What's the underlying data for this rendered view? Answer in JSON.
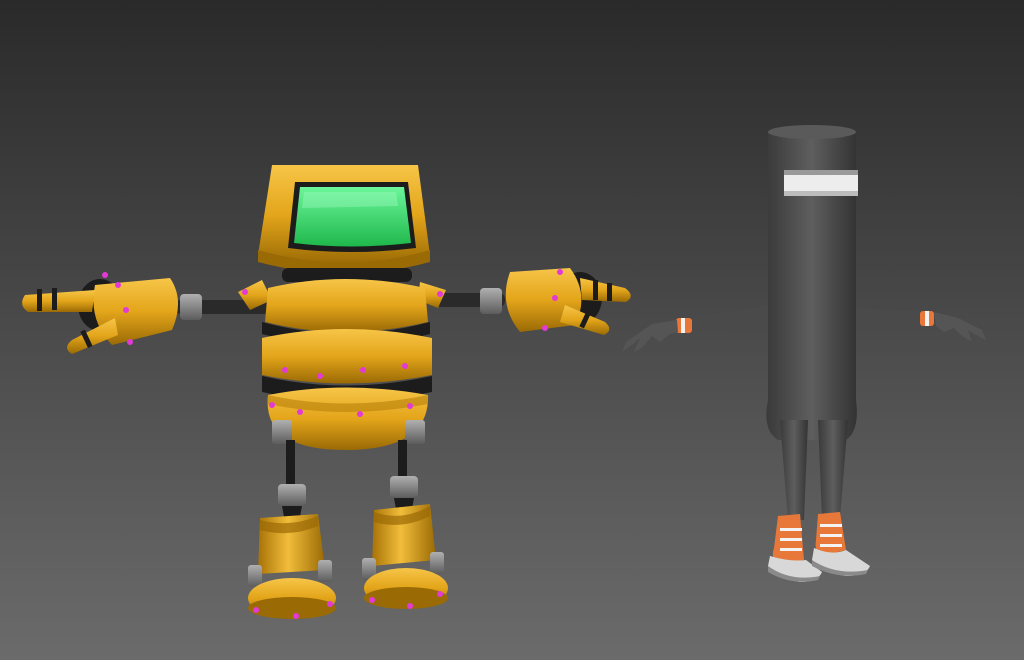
{
  "viewport": {
    "background_top": "#2a2a2a",
    "background_bottom": "#6b6b6b"
  },
  "models": [
    {
      "name": "yellow-robot",
      "colors": {
        "body": "#e3a51a",
        "body_dark": "#9a6a05",
        "screen": "#35e06a",
        "rivet": "#e23ad6",
        "joint": "#8c8c8c",
        "dark": "#1c1c1c"
      }
    },
    {
      "name": "gray-tube-character",
      "colors": {
        "body": "#4a4a4a",
        "body_light": "#6a6a6a",
        "visor": "#e8e8e8",
        "accent": "#e8773a",
        "sole": "#d8d8d8"
      }
    }
  ]
}
